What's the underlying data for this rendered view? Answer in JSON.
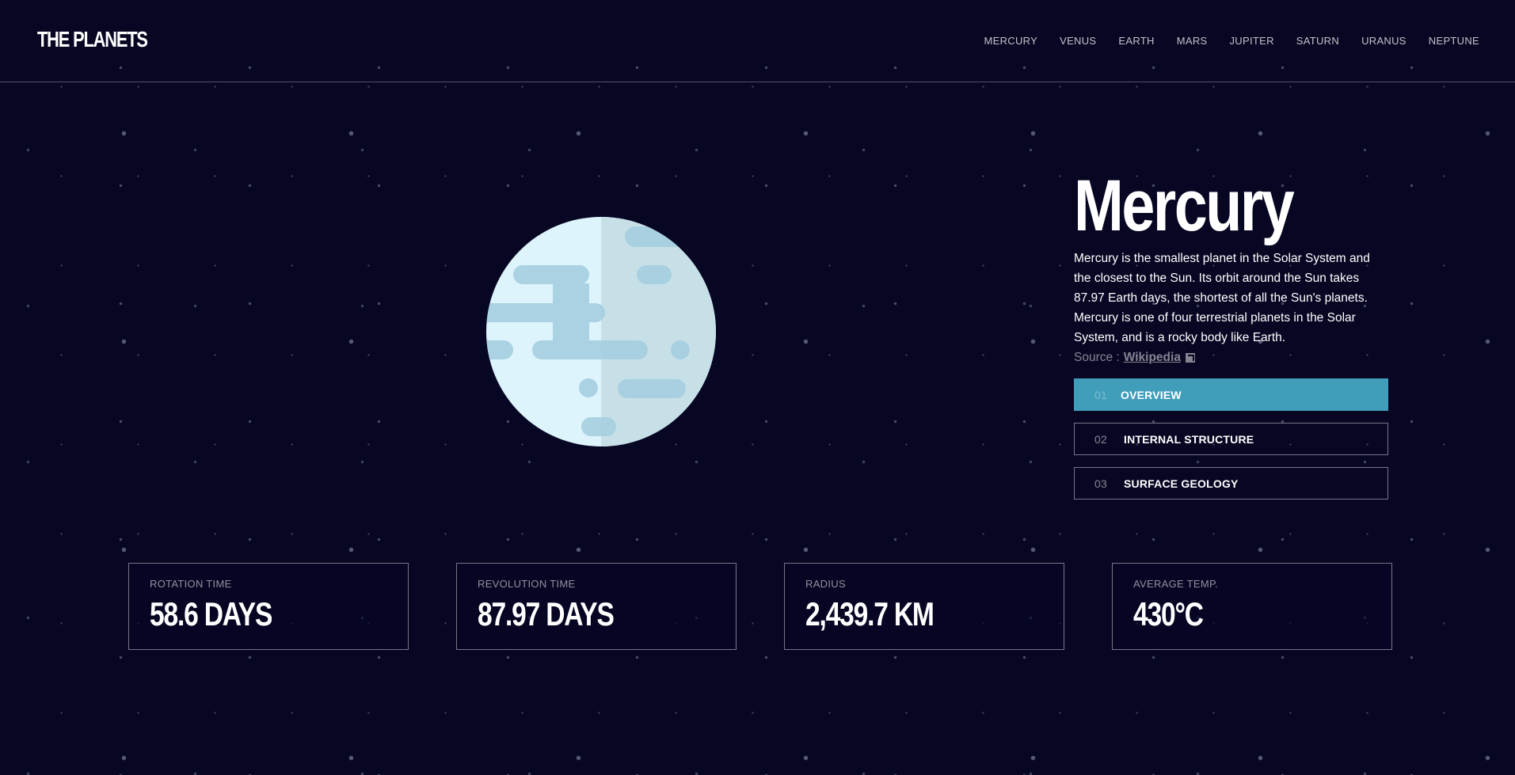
{
  "header": {
    "logo": "THE PLANETS",
    "nav": [
      "MERCURY",
      "VENUS",
      "EARTH",
      "MARS",
      "JUPITER",
      "SATURN",
      "URANUS",
      "NEPTUNE"
    ]
  },
  "planet": {
    "name": "Mercury",
    "description": "Mercury is the smallest planet in the Solar System and the closest to the Sun. Its orbit around the Sun takes 87.97 Earth days, the shortest of all the Sun's planets. Mercury is one of four terrestrial planets in the Solar System, and is a rocky body like Earth.",
    "source_label": "Source :",
    "source_link": "Wikipedia",
    "source_icon": "external-link-icon"
  },
  "tabs": [
    {
      "num": "01",
      "label": "OVERVIEW",
      "active": true
    },
    {
      "num": "02",
      "label": "INTERNAL STRUCTURE",
      "active": false
    },
    {
      "num": "03",
      "label": "SURFACE GEOLOGY",
      "active": false
    }
  ],
  "stats": [
    {
      "label": "ROTATION TIME",
      "value": "58.6 DAYS"
    },
    {
      "label": "REVOLUTION TIME",
      "value": "87.97 DAYS"
    },
    {
      "label": "RADIUS",
      "value": "2,439.7 KM"
    },
    {
      "label": "AVERAGE TEMP.",
      "value": "430°C"
    }
  ],
  "colors": {
    "background": "#070724",
    "accent": "#419ebb",
    "planet_light": "#def4fc",
    "planet_shade": "#c7e0e8",
    "planet_spots": "#a5cfdf"
  }
}
